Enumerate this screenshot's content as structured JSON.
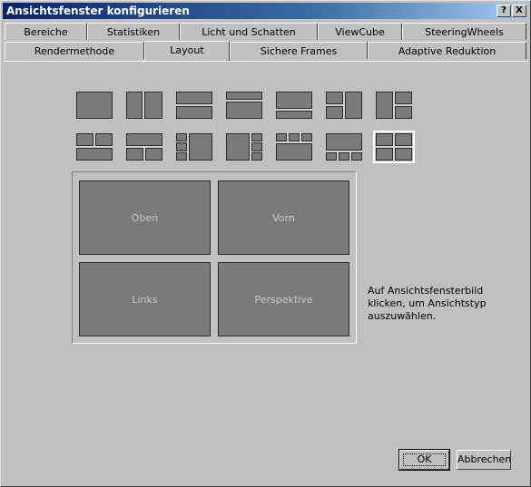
{
  "window": {
    "title": "Ansichtsfenster konfigurieren",
    "help_label": "?",
    "close_label": "X"
  },
  "tabs_row1": [
    "Bereiche",
    "Statistiken",
    "Licht und Schatten",
    "ViewCube",
    "SteeringWheels"
  ],
  "tabs_row2": [
    "Rendermethode",
    "Layout",
    "Sichere Frames",
    "Adaptive Reduktion"
  ],
  "active_tab": "Layout",
  "layouts": {
    "selected_index": 13,
    "count": 14
  },
  "preview": {
    "viewports": [
      "Oben",
      "Vorn",
      "Links",
      "Perspektive"
    ]
  },
  "hint": "Auf Ansichtsfensterbild klicken, um Ansichtstyp auszuwählen.",
  "buttons": {
    "ok": "OK",
    "cancel": "Abbrechen"
  }
}
